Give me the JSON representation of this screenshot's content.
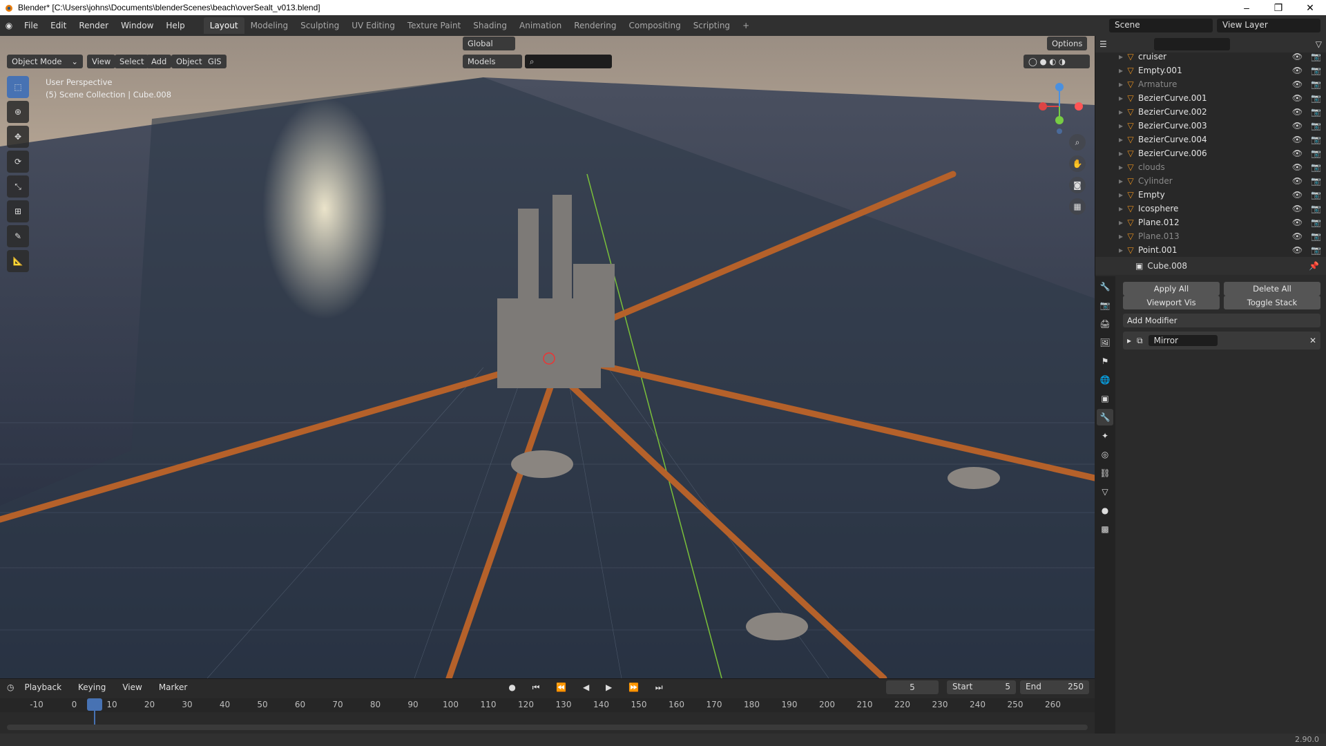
{
  "window": {
    "title": "Blender* [C:\\Users\\johns\\Documents\\blenderScenes\\beach\\overSealt_v013.blend]"
  },
  "menu": [
    "File",
    "Edit",
    "Render",
    "Window",
    "Help"
  ],
  "workspaces": [
    "Layout",
    "Modeling",
    "Sculpting",
    "UV Editing",
    "Texture Paint",
    "Shading",
    "Animation",
    "Rendering",
    "Compositing",
    "Scripting"
  ],
  "active_workspace": "Layout",
  "scene": {
    "label": "Scene",
    "view_layer": "View Layer"
  },
  "viewport": {
    "mode": "Object Mode",
    "menus": [
      "View",
      "Select",
      "Add",
      "Object",
      "GIS"
    ],
    "transform_orientation": "Global",
    "selectability": "Models",
    "options": "Options",
    "info_line1": "User Perspective",
    "info_line2": "(5) Scene Collection | Cube.008",
    "gizmo_axes": [
      "X",
      "Y",
      "Z"
    ]
  },
  "outliner": {
    "items": [
      {
        "name": "cruiser",
        "dim": false
      },
      {
        "name": "Empty.001",
        "dim": false
      },
      {
        "name": "Armature",
        "dim": true
      },
      {
        "name": "BezierCurve.001",
        "dim": false
      },
      {
        "name": "BezierCurve.002",
        "dim": false
      },
      {
        "name": "BezierCurve.003",
        "dim": false
      },
      {
        "name": "BezierCurve.004",
        "dim": false
      },
      {
        "name": "BezierCurve.006",
        "dim": false
      },
      {
        "name": "clouds",
        "dim": true
      },
      {
        "name": "Cylinder",
        "dim": true
      },
      {
        "name": "Empty",
        "dim": false
      },
      {
        "name": "Icosphere",
        "dim": false
      },
      {
        "name": "Plane.012",
        "dim": false
      },
      {
        "name": "Plane.013",
        "dim": true
      },
      {
        "name": "Point.001",
        "dim": false
      }
    ]
  },
  "properties": {
    "object": "Cube.008",
    "apply_all": "Apply All",
    "delete_all": "Delete All",
    "viewport_vis": "Viewport Vis",
    "toggle_stack": "Toggle Stack",
    "add_modifier": "Add Modifier",
    "modifier_name": "Mirror"
  },
  "timeline": {
    "menus": [
      "Playback",
      "Keying",
      "View",
      "Marker"
    ],
    "current_frame": "5",
    "start_label": "Start",
    "start": "5",
    "end_label": "End",
    "end": "250",
    "ticks": [
      "-10",
      "0",
      "10",
      "20",
      "30",
      "40",
      "50",
      "60",
      "70",
      "80",
      "90",
      "100",
      "110",
      "120",
      "130",
      "140",
      "150",
      "160",
      "170",
      "180",
      "190",
      "200",
      "210",
      "220",
      "230",
      "240",
      "250",
      "260"
    ]
  },
  "status": {
    "version": "2.90.0"
  },
  "colors": {
    "accent": "#4772b3",
    "header": "#303030",
    "panel": "#282828"
  }
}
